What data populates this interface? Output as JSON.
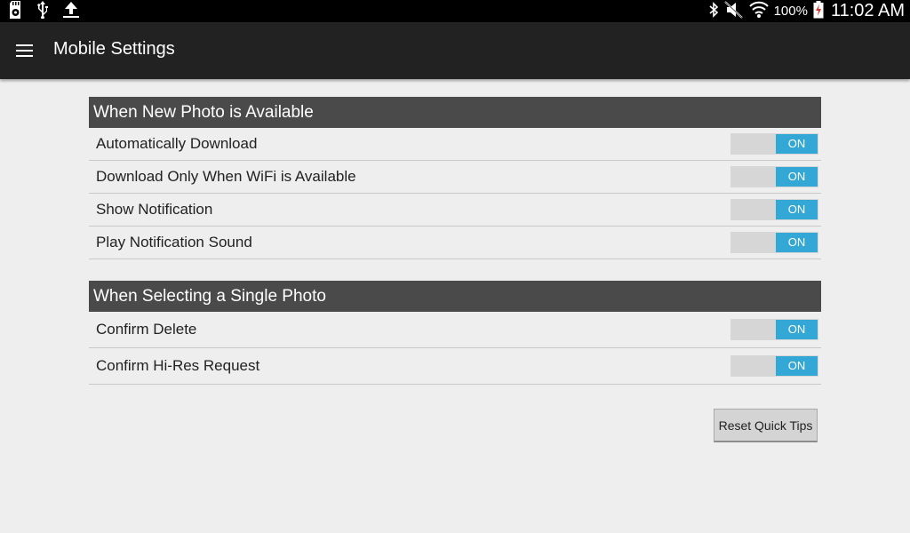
{
  "status_bar": {
    "battery_percent": "100%",
    "time": "11:02 AM",
    "icons_left": [
      "sd-card-icon",
      "usb-icon",
      "upload-icon"
    ],
    "icons_right": [
      "bluetooth-icon",
      "mute-icon",
      "wifi-icon",
      "battery-icon"
    ]
  },
  "app_bar": {
    "title": "Mobile Settings",
    "menu_icon": "hamburger-menu-icon"
  },
  "sections": [
    {
      "header": "When New Photo is Available",
      "items": [
        {
          "label": "Automatically Download",
          "state": "ON"
        },
        {
          "label": "Download Only When WiFi is Available",
          "state": "ON"
        },
        {
          "label": "Show Notification",
          "state": "ON"
        },
        {
          "label": "Play Notification Sound",
          "state": "ON"
        }
      ]
    },
    {
      "header": "When Selecting a Single Photo",
      "items": [
        {
          "label": "Confirm Delete",
          "state": "ON"
        },
        {
          "label": "Confirm Hi-Res Request",
          "state": "ON"
        }
      ]
    }
  ],
  "reset_button": {
    "label": "Reset Quick Tips"
  },
  "colors": {
    "toggle_on": "#33a7d6",
    "section_header": "#4a4a4a",
    "action_bar": "#222222",
    "background": "#eeeeee"
  }
}
